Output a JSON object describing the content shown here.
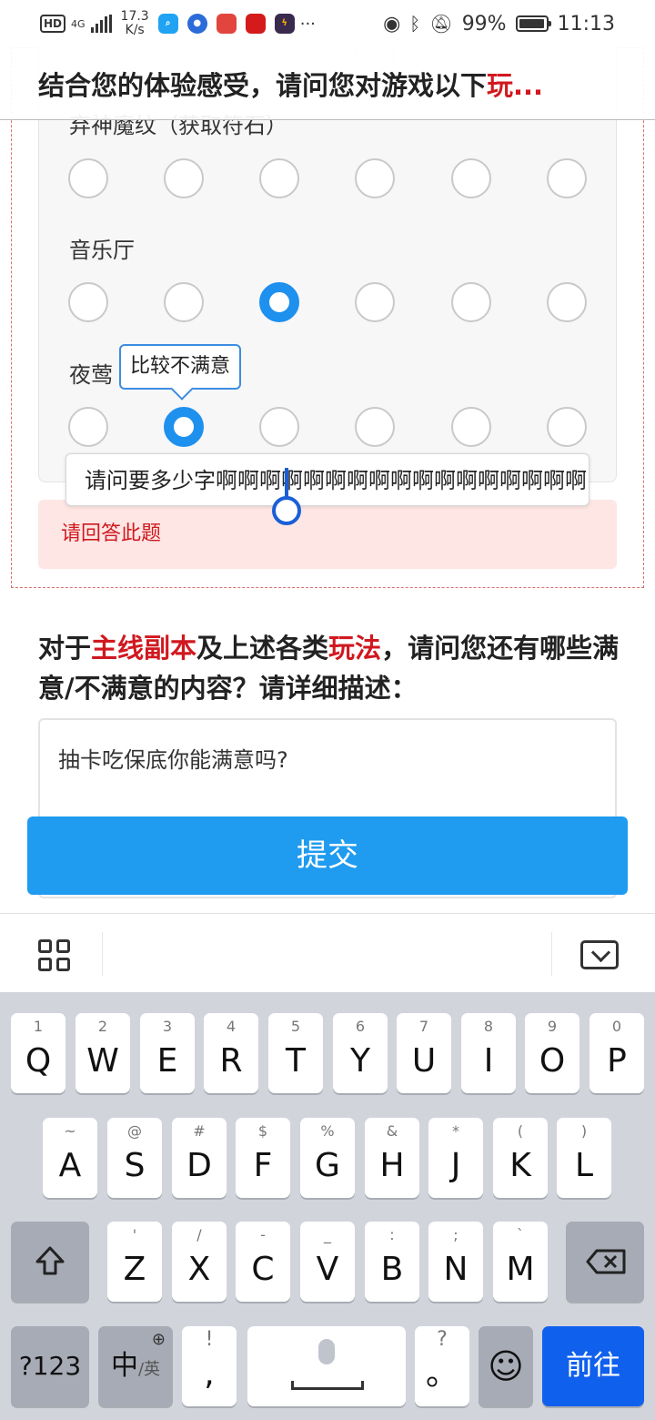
{
  "status_bar": {
    "hd": "HD",
    "network": "4G",
    "speed_value": "17.3",
    "speed_unit": "K/s",
    "battery": "99%",
    "time": "11:13",
    "more": "···"
  },
  "sticky_question": {
    "prefix": "结合您的体验感受，请问您对游戏以下",
    "highlight": "玩...",
    "hidden_row_label": "弃神魔纹（获取符石）"
  },
  "rating_rows": [
    {
      "label": "弃神魔纹（获取符石）",
      "selected_index": -1
    },
    {
      "label": "音乐厅",
      "selected_index": 2
    },
    {
      "label": "夜莺",
      "selected_index": 1
    }
  ],
  "tooltip": "比较不满意",
  "text_field_value": "请问要多少字啊啊啊啊啊啊啊啊啊啊啊啊啊啊啊啊啊",
  "error_message": "请回答此题",
  "question2": {
    "part1": "对于",
    "highlight1": "主线副本",
    "part2": "及上述各类",
    "highlight2": "玩法",
    "part3": "，请问您还有哪些满意/不满意的内容？请详细描述："
  },
  "textarea_value": "抽卡吃保底你能满意吗?",
  "submit_label": "提交",
  "keyboard": {
    "row1": [
      {
        "main": "Q",
        "hint": "1"
      },
      {
        "main": "W",
        "hint": "2"
      },
      {
        "main": "E",
        "hint": "3"
      },
      {
        "main": "R",
        "hint": "4"
      },
      {
        "main": "T",
        "hint": "5"
      },
      {
        "main": "Y",
        "hint": "6"
      },
      {
        "main": "U",
        "hint": "7"
      },
      {
        "main": "I",
        "hint": "8"
      },
      {
        "main": "O",
        "hint": "9"
      },
      {
        "main": "P",
        "hint": "0"
      }
    ],
    "row2": [
      {
        "main": "A",
        "hint": "~"
      },
      {
        "main": "S",
        "hint": "@"
      },
      {
        "main": "D",
        "hint": "#"
      },
      {
        "main": "F",
        "hint": "$"
      },
      {
        "main": "G",
        "hint": "%"
      },
      {
        "main": "H",
        "hint": "&"
      },
      {
        "main": "J",
        "hint": "*"
      },
      {
        "main": "K",
        "hint": "("
      },
      {
        "main": "L",
        "hint": ")"
      }
    ],
    "row3": [
      {
        "main": "Z",
        "hint": "'"
      },
      {
        "main": "X",
        "hint": "/"
      },
      {
        "main": "C",
        "hint": "-"
      },
      {
        "main": "V",
        "hint": "_"
      },
      {
        "main": "B",
        "hint": ":"
      },
      {
        "main": "N",
        "hint": ";"
      },
      {
        "main": "M",
        "hint": "`"
      }
    ],
    "num_key": "?123",
    "lang_key_main": "中",
    "lang_key_sub": "/英",
    "comma_hint": "!",
    "comma_main": ",",
    "period_hint": "?",
    "period_main": "。",
    "go_key": "前往"
  },
  "colors": {
    "accent_blue": "#1f9bf0",
    "error_red": "#d0191f",
    "go_blue": "#1060ee"
  }
}
